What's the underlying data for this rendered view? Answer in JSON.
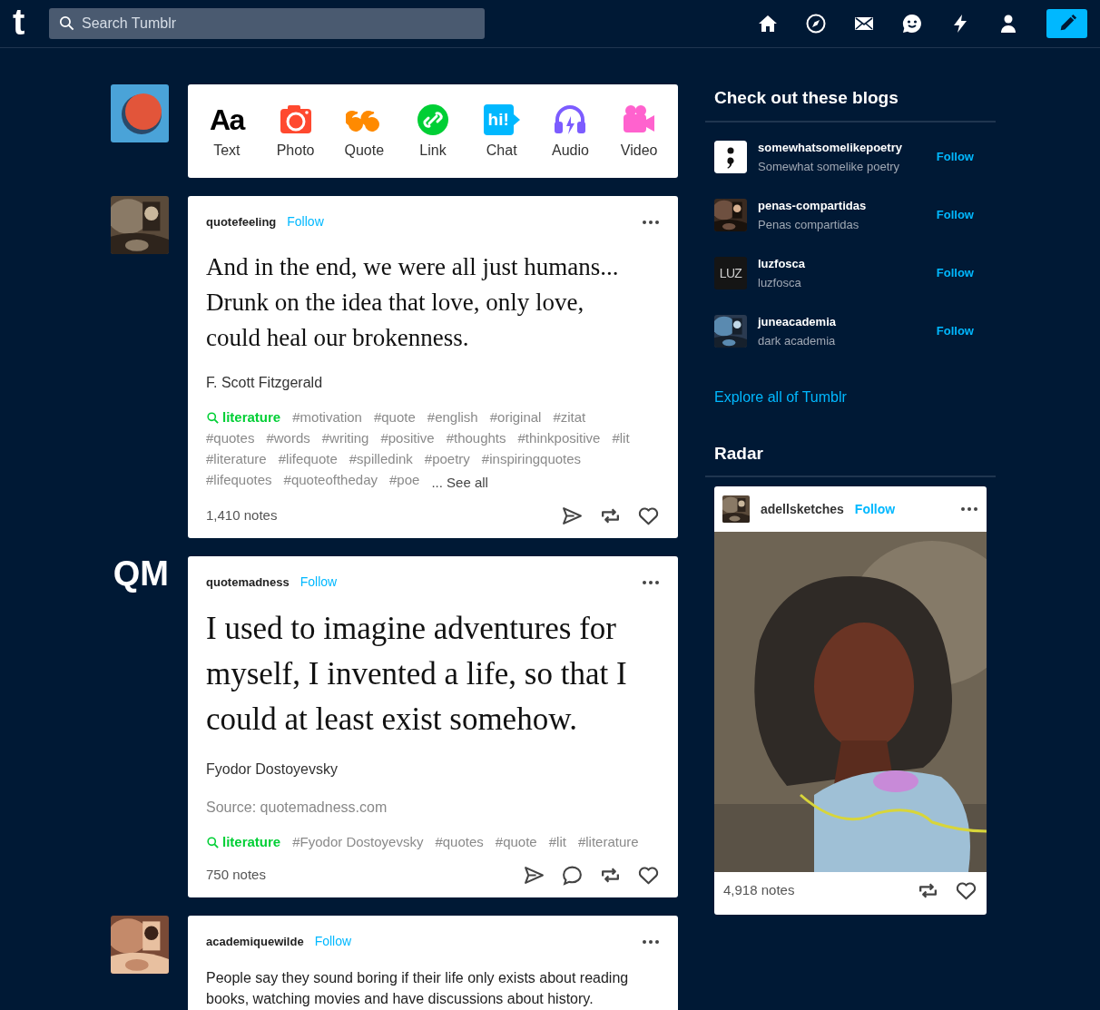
{
  "header": {
    "logo": "t",
    "search": {
      "placeholder": "Search Tumblr"
    },
    "nav": [
      {
        "kind": "home"
      },
      {
        "kind": "explore"
      },
      {
        "kind": "inbox"
      },
      {
        "kind": "messages"
      },
      {
        "kind": "activity"
      },
      {
        "kind": "account"
      }
    ],
    "compose": {
      "kind": "compose"
    }
  },
  "composer": {
    "avatar": {
      "kind": "illustration"
    },
    "types": [
      {
        "kind": "text",
        "label": "Text",
        "icon_text": "Aa"
      },
      {
        "label": "Photo"
      },
      {
        "kind": "quote",
        "label": "Quote"
      },
      {
        "kind": "link",
        "label": "Link"
      },
      {
        "kind": "chat",
        "label": "Chat",
        "icon_text": "hi!"
      },
      {
        "kind": "audio",
        "label": "Audio"
      },
      {
        "kind": "video",
        "label": "Video"
      }
    ]
  },
  "posts": [
    {
      "kind": "quote",
      "avatar": {
        "kind": "picture"
      },
      "blog": "quotefeeling",
      "follow": "Follow",
      "quote": "And in the end, we were all just humans... Drunk on the idea that love, only love, could heal our brokenness.",
      "author": "F. Scott Fitzgerald",
      "featured_tag": "literature",
      "tags": [
        "#motivation",
        "#quote",
        "#english",
        "#original",
        "#zitat",
        "#quotes",
        "#words",
        "#writing",
        "#positive",
        "#thoughts",
        "#thinkpositive",
        "#lit",
        "#literature",
        "#lifequote",
        "#spilledink",
        "#poetry",
        "#inspiringquotes",
        "#lifequotes",
        "#quoteoftheday",
        "#poe"
      ],
      "see_all": "... See all",
      "notes": "1,410 notes",
      "actions": [
        {
          "kind": "share"
        },
        {
          "kind": "reblog"
        },
        {
          "kind": "like"
        }
      ]
    },
    {
      "kind": "big_quote",
      "avatar": {
        "kind": "text",
        "text": "QM"
      },
      "blog": "quotemadness",
      "follow": "Follow",
      "quote": "I used to imagine adventures for myself, I invented a life, so that I could at least exist somehow.",
      "author": "Fyodor Dostoyevsky",
      "source": "Source: quotemadness.com",
      "featured_tag": "literature",
      "tags": [
        "#Fyodor Dostoyevsky",
        "#quotes",
        "#quote",
        "#lit",
        "#literature"
      ],
      "notes": "750 notes",
      "actions": [
        {
          "kind": "share"
        },
        {
          "kind": "reply"
        },
        {
          "kind": "reblog"
        },
        {
          "kind": "like"
        }
      ]
    },
    {
      "kind": "text",
      "avatar": {
        "kind": "picture"
      },
      "blog": "academiquewilde",
      "follow": "Follow",
      "body": "People say they sound boring if their life only exists about reading books, watching movies and have discussions about history."
    }
  ],
  "sidebar": {
    "blogs_title": "Check out these blogs",
    "blogs": [
      {
        "avatar": {
          "kind": "semicolon"
        },
        "name": "somewhatsomelikepoetry",
        "title": "Somewhat somelike poetry",
        "follow": "Follow"
      },
      {
        "avatar": {
          "kind": "picture"
        },
        "name": "penas-compartidas",
        "title": "Penas compartidas",
        "follow": "Follow"
      },
      {
        "avatar": {
          "kind": "text",
          "text": "LUZ"
        },
        "name": "luzfosca",
        "title": "luzfosca",
        "follow": "Follow"
      },
      {
        "avatar": {
          "kind": "picture"
        },
        "name": "juneacademia",
        "title": "dark academia",
        "follow": "Follow"
      }
    ],
    "explore": "Explore all of Tumblr",
    "radar_title": "Radar",
    "radar": {
      "blog": "adellsketches",
      "follow": "Follow",
      "image": {
        "kind": "picture"
      },
      "notes": "4,918 notes",
      "actions": [
        {
          "kind": "reblog"
        },
        {
          "kind": "like"
        }
      ]
    }
  }
}
